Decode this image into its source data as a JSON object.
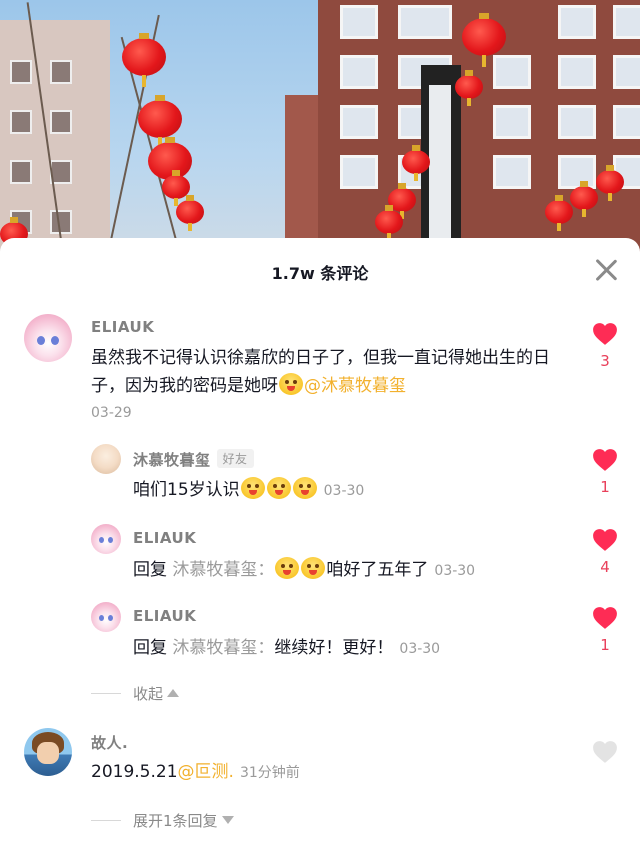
{
  "sheet": {
    "title": "1.7w 条评论"
  },
  "comments": [
    {
      "user": "ELIAUK",
      "text": "虽然我不记得认识徐嘉欣的日子了，但我一直记得她出生的日子，因为我的密码是她呀",
      "mention": "@沐慕牧暮玺",
      "time": "03-29",
      "likes": "3",
      "liked": true,
      "replies": [
        {
          "user": "沐慕牧暮玺",
          "tag": "好友",
          "text": "咱们15岁认识",
          "time": "03-30",
          "likes": "1",
          "liked": true
        },
        {
          "user": "ELIAUK",
          "reply_prefix": "回复",
          "reply_to": "沐慕牧暮玺：",
          "text": "咱好了五年了",
          "time": "03-30",
          "likes": "4",
          "liked": true
        },
        {
          "user": "ELIAUK",
          "reply_prefix": "回复",
          "reply_to": "沐慕牧暮玺：",
          "text": "继续好！更好！",
          "time": "03-30",
          "likes": "1",
          "liked": true
        }
      ],
      "collapse_label": "收起"
    },
    {
      "user": "故人.",
      "text": "2019.5.21",
      "mention": "@叵测.",
      "time": "31分钟前",
      "liked": false,
      "expand_label": "展开1条回复"
    }
  ],
  "colors": {
    "heart_liked": "#fe2c55",
    "heart_unliked": "#e3e3e3",
    "mention": "#f2b12e"
  },
  "icons": {
    "close": "close-icon",
    "like": "heart-icon",
    "collapse": "triangle-up-icon",
    "expand": "triangle-down-icon",
    "emoji": "laughing-emoji-icon"
  }
}
